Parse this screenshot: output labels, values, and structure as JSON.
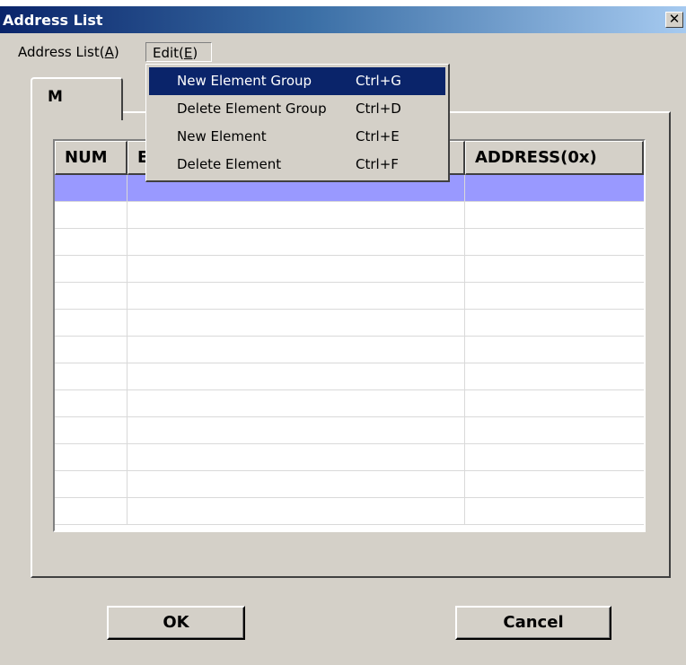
{
  "window": {
    "title": "Address List",
    "close_glyph": "✕"
  },
  "menubar": {
    "address_list": {
      "label": "Address List(",
      "mnemonic": "A",
      "suffix": ")"
    },
    "edit": {
      "label": "Edit(",
      "mnemonic": "E",
      "suffix": ")"
    }
  },
  "edit_menu": {
    "items": [
      {
        "label": "New Element Group",
        "shortcut": "Ctrl+G",
        "highlighted": true
      },
      {
        "label": "Delete Element Group",
        "shortcut": "Ctrl+D",
        "highlighted": false
      },
      {
        "label": "New Element",
        "shortcut": "Ctrl+E",
        "highlighted": false
      },
      {
        "label": "Delete Element",
        "shortcut": "Ctrl+F",
        "highlighted": false
      }
    ]
  },
  "tabs": [
    {
      "label": "M",
      "active": true
    }
  ],
  "table": {
    "columns": [
      "NUM",
      "E",
      "ADDRESS(0x)"
    ],
    "rows": [
      [
        "",
        "",
        ""
      ],
      [
        "",
        "",
        ""
      ],
      [
        "",
        "",
        ""
      ],
      [
        "",
        "",
        ""
      ],
      [
        "",
        "",
        ""
      ],
      [
        "",
        "",
        ""
      ],
      [
        "",
        "",
        ""
      ],
      [
        "",
        "",
        ""
      ],
      [
        "",
        "",
        ""
      ],
      [
        "",
        "",
        ""
      ],
      [
        "",
        "",
        ""
      ],
      [
        "",
        "",
        ""
      ],
      [
        "",
        "",
        ""
      ]
    ],
    "selected_row": 0
  },
  "buttons": {
    "ok": "OK",
    "cancel": "Cancel"
  },
  "colors": {
    "selection": "#9999ff",
    "menu_highlight": "#0a246a",
    "title_start": "#0a246a",
    "title_end": "#a6caf0",
    "face": "#d4d0c8"
  }
}
